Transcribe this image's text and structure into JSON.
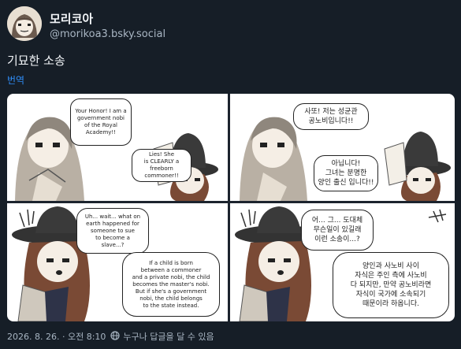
{
  "post": {
    "display_name": "모리코아",
    "handle": "@morikoa3.bsky.social",
    "text": "기묘한 소송",
    "translate_label": "번역",
    "timestamp": "2026. 8. 26. · 오전 8:10",
    "reply_setting": "누구나 답글을 달 수 있음"
  },
  "comic": {
    "panel1": {
      "bubble1": "Your Honor! I am a\ngovernment nobi\nof the Royal\nAcademy!!",
      "bubble2": "Lies! She\nis CLEARLY a\nfreeborn commoner!!"
    },
    "panel2": {
      "bubble1": "사또! 저는 성균관\n공노비입니다!!",
      "bubble2": "아닙니다!\n그녀는 분명한\n양인 출신 입니다!!"
    },
    "panel3": {
      "bubble1": "Uh... wait... what on\nearth happened for\nsomeone to sue\nto become a\nslave...?",
      "bubble2": "If a child is born\nbetween a commoner\nand a private nobi, the child\nbecomes the master's nobi.\nBut if she's a government\nnobi, the child belongs\nto the state instead."
    },
    "panel4": {
      "bubble1": "어... 그... 도대체\n무슨일이 있길래\n이런 소송이...?",
      "bubble2": "양인과 사노비 사이\n자식은 주인 측에 사노비\n다 되지만, 만약 공노비라면\n자식이 국가에 소속되기\n때문이라 하옵니다."
    }
  },
  "colors": {
    "background": "#161e27",
    "link": "#2f8cf5",
    "muted": "#a9b6c3"
  }
}
